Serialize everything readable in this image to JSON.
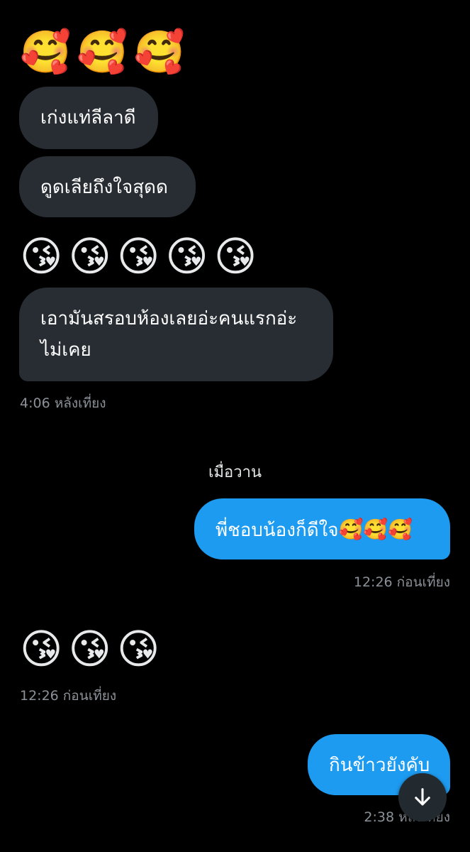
{
  "messages": {
    "m1": {
      "emoji": [
        "🥰",
        "🥰",
        "🥰"
      ]
    },
    "m2": {
      "text": "เก่งแท่ลีลาดี"
    },
    "m3": {
      "text": "ดูดเลียถึงใจสุดด"
    },
    "m4": {
      "emoji": [
        "😘",
        "😘",
        "😘",
        "😘",
        "😘"
      ]
    },
    "m5": {
      "line1": "เอามันสรอบห้องเลยอ่ะคนแรกอ่ะ",
      "line2": "ไม่เคย"
    },
    "t1": "4:06 หลังเที่ยง",
    "day_separator": "เมื่อวาน",
    "m6": {
      "text": "พี่ชอบน้องก็ดีใจ",
      "emoji": "🥰🥰🥰"
    },
    "t2": "12:26 ก่อนเที่ยง",
    "m7": {
      "emoji": [
        "😘",
        "😘",
        "😘"
      ]
    },
    "t3": "12:26 ก่อนเที่ยง",
    "m8": {
      "text": "กินข้าวยังคับ"
    },
    "t4": "2:38 หลังเที่ยง"
  },
  "scroll_button": {
    "icon": "arrow-down-icon"
  },
  "colors": {
    "background": "#000000",
    "incoming_bubble": "#282d33",
    "outgoing_bubble": "#1d9bf0",
    "timestamp": "#8b9198"
  }
}
